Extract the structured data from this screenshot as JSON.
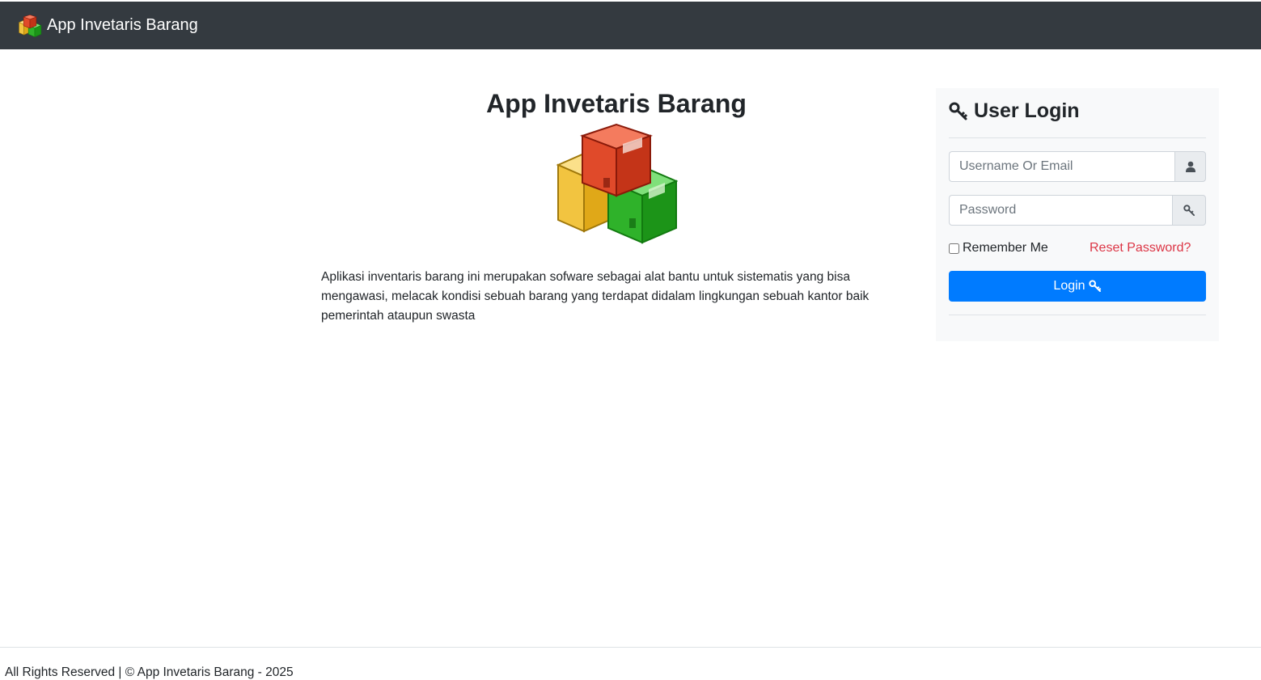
{
  "navbar": {
    "brand_label": "App Invetaris Barang",
    "brand_icon": "boxes-icon",
    "background": "#343a40"
  },
  "hero": {
    "title": "App Invetaris Barang",
    "image_icon": "boxes-icon",
    "description": "Aplikasi inventaris barang ini merupakan sofware sebagai alat bantu untuk sistematis yang bisa mengawasi, melacak kondisi sebuah barang yang terdapat didalam lingkungan sebuah kantor baik pemerintah ataupun swasta"
  },
  "login": {
    "title": "User Login",
    "title_icon": "key-icon",
    "username_placeholder": "Username Or Email",
    "username_value": "",
    "username_icon": "user-icon",
    "password_placeholder": "Password",
    "password_value": "",
    "password_icon": "key-icon",
    "remember_label": "Remember Me",
    "remember_checked": false,
    "reset_label": "Reset Password?",
    "submit_label": "Login",
    "submit_icon": "key-icon"
  },
  "footer": {
    "text": "All Rights Reserved | © App Invetaris Barang - 2025"
  },
  "colors": {
    "primary": "#007bff",
    "danger": "#dc3545",
    "panel_bg": "#f8f9fa",
    "navbar_bg": "#343a40"
  }
}
